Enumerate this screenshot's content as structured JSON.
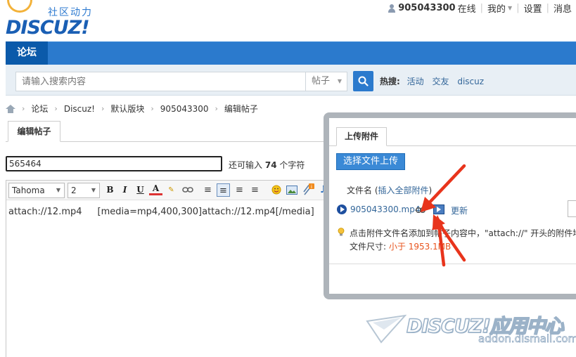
{
  "header": {
    "logo_cn": "社区动力",
    "logo_en": "DISCUZ!",
    "user": {
      "name": "905043300",
      "status": "在线",
      "mine": "我的",
      "settings": "设置",
      "messages": "消息"
    }
  },
  "nav": {
    "tab": "论坛"
  },
  "search": {
    "placeholder": "请输入搜索内容",
    "scope": "帖子",
    "hot_label": "热搜:",
    "hot": [
      "活动",
      "交友",
      "discuz"
    ]
  },
  "breadcrumb": [
    "论坛",
    "Discuz!",
    "默认版块",
    "905043300",
    "编辑帖子"
  ],
  "edit_tab": "编辑帖子",
  "subject": {
    "value": "565464",
    "remain_prefix": "还可输入",
    "remain_count": "74",
    "remain_suffix": "个字符"
  },
  "editor": {
    "font": "Tahoma",
    "size": "2",
    "body_part1": "attach://12.mp4",
    "body_part2": "[media=mp4,400,300]attach://12.mp4[/media]"
  },
  "upload": {
    "tab": "上传附件",
    "button": "选择文件上传",
    "col_filename": "文件名",
    "insert_all": "插入全部附件",
    "file": {
      "name": "905043300.mp4",
      "update": "更新"
    },
    "tip": "点击附件文件名添加到帖子内容中，\"attach://\" 开头的附件地",
    "size_label": "文件尺寸:",
    "size_value": "小于 1953.1MB"
  },
  "watermark": {
    "brand": "DISCUZ!应用中心",
    "url": "addon.dismall.com"
  },
  "colors": {
    "primary": "#2b7acd",
    "nav_active": "#0b5aaa",
    "link": "#336699",
    "arrow": "#e8341c",
    "size_value": "#e8541e"
  }
}
